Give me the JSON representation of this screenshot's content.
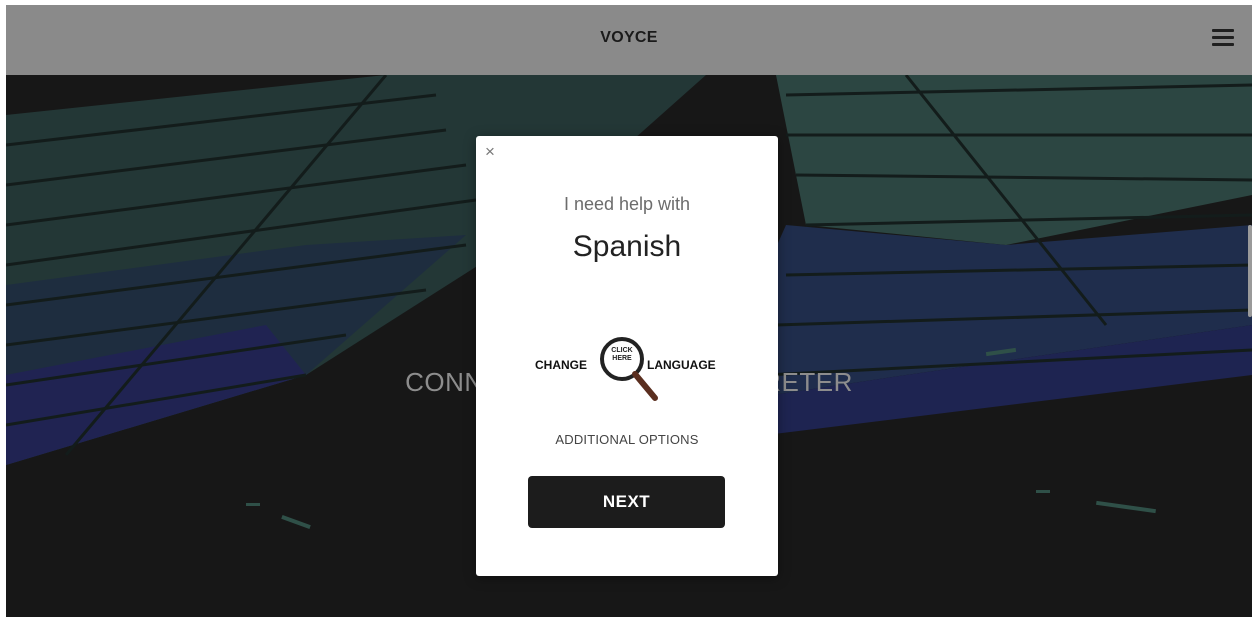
{
  "header": {
    "brand": "VOYCE",
    "menu_icon": "hamburger-menu-icon"
  },
  "hero": {
    "headline": "CONNECT WITH AN INTERPRETER"
  },
  "modal": {
    "close_label": "×",
    "subtitle": "I need help with",
    "language": "Spanish",
    "change_language": {
      "left_text": "CHANGE",
      "magnifier_line1": "CLICK",
      "magnifier_line2": "HERE",
      "right_text": "LANGUAGE",
      "icon": "magnifying-glass-icon"
    },
    "additional_options": "ADDITIONAL OPTIONS",
    "next_label": "NEXT"
  },
  "colors": {
    "header_bg": "#8a8a8a",
    "overlay_dark": "#1e1e1e",
    "button_bg": "#1c1c1c",
    "modal_bg": "#ffffff"
  }
}
